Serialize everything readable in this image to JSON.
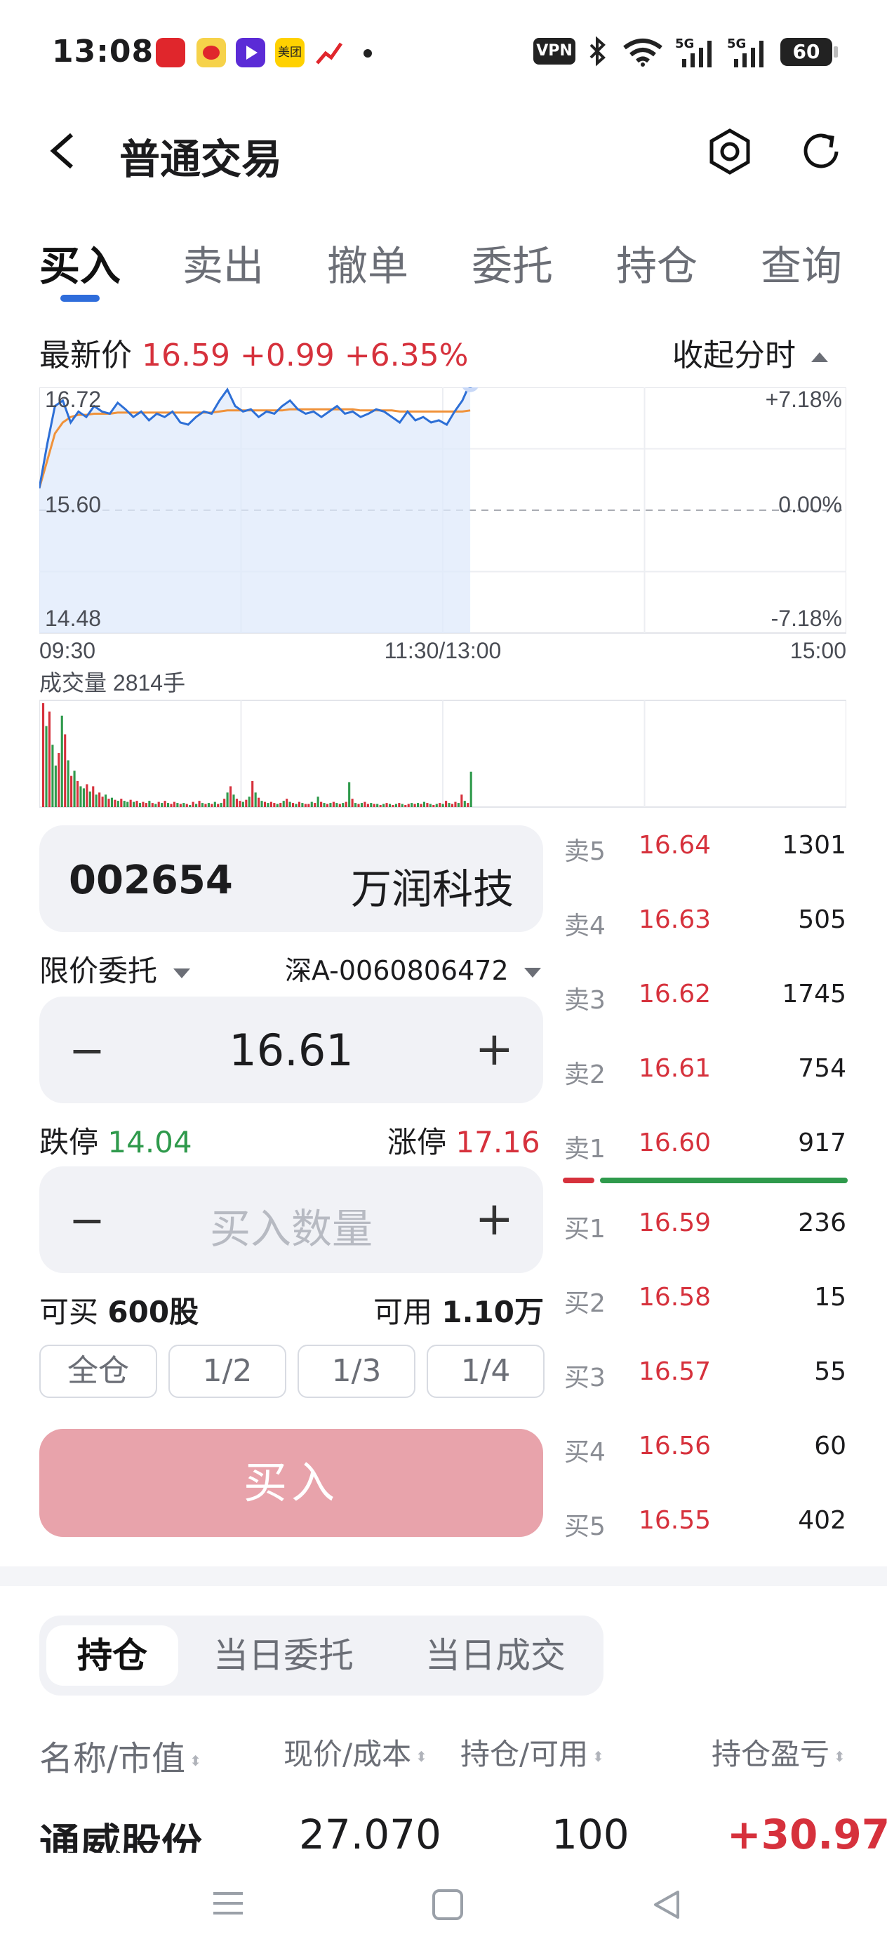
{
  "status_bar": {
    "time": "13:08",
    "vpn": "VPN",
    "battery": "60",
    "signal1": "5G",
    "signal2": "5G",
    "app_icons": [
      "app-icon-securities",
      "weibo-icon",
      "video-icon",
      "meituan-icon",
      "stock-icon"
    ],
    "meituan_label": "美团"
  },
  "header": {
    "title": "普通交易"
  },
  "tabs": [
    {
      "label": "买入",
      "active": true
    },
    {
      "label": "卖出"
    },
    {
      "label": "撤单"
    },
    {
      "label": "委托"
    },
    {
      "label": "持仓"
    },
    {
      "label": "查询"
    }
  ],
  "quote": {
    "label": "最新价",
    "price": "16.59",
    "change": "+0.99",
    "change_pct": "+6.35%",
    "collapse_label": "收起分时"
  },
  "chart_data": {
    "type": "line",
    "y_labels": [
      "16.72",
      "15.60",
      "14.48"
    ],
    "pct_labels": [
      "+7.18%",
      "0.00%",
      "-7.18%"
    ],
    "x_labels": [
      "09:30",
      "11:30/13:00",
      "15:00"
    ],
    "ylim": [
      14.48,
      16.72
    ],
    "prev_close": 15.6,
    "series": [
      {
        "values": [
          15.8,
          16.2,
          16.55,
          16.6,
          16.4,
          16.5,
          16.45,
          16.55,
          16.5,
          16.48,
          16.58,
          16.52,
          16.45,
          16.5,
          16.42,
          16.48,
          16.45,
          16.5,
          16.4,
          16.38,
          16.45,
          16.5,
          16.48,
          16.6,
          16.7,
          16.55,
          16.5,
          16.52,
          16.45,
          16.5,
          16.48,
          16.55,
          16.6,
          16.52,
          16.48,
          16.5,
          16.45,
          16.5,
          16.55,
          16.48,
          16.5,
          16.45,
          16.48,
          16.52,
          16.5,
          16.45,
          16.4,
          16.5,
          16.42,
          16.45,
          16.4,
          16.42,
          16.38,
          16.5,
          16.6,
          16.76
        ]
      },
      {
        "values": [
          15.8,
          16.05,
          16.3,
          16.4,
          16.45,
          16.47,
          16.47,
          16.48,
          16.48,
          16.48,
          16.49,
          16.49,
          16.49,
          16.49,
          16.49,
          16.49,
          16.49,
          16.49,
          16.49,
          16.49,
          16.49,
          16.49,
          16.49,
          16.5,
          16.51,
          16.51,
          16.51,
          16.51,
          16.51,
          16.51,
          16.51,
          16.51,
          16.52,
          16.52,
          16.52,
          16.52,
          16.52,
          16.52,
          16.52,
          16.52,
          16.52,
          16.51,
          16.51,
          16.51,
          16.51,
          16.51,
          16.5,
          16.5,
          16.5,
          16.5,
          16.5,
          16.5,
          16.5,
          16.5,
          16.5,
          16.51
        ]
      }
    ],
    "volume_label": "成交量 2814手",
    "volume": [
      100,
      78,
      92,
      60,
      40,
      52,
      88,
      70,
      45,
      30,
      35,
      25,
      20,
      18,
      22,
      15,
      20,
      12,
      14,
      10,
      12,
      8,
      9,
      7,
      6,
      8,
      6,
      5,
      7,
      5,
      6,
      4,
      5,
      4,
      6,
      4,
      3,
      5,
      4,
      6,
      4,
      3,
      5,
      4,
      3,
      4,
      3,
      2,
      5,
      3,
      6,
      4,
      3,
      4,
      3,
      5,
      3,
      4,
      8,
      14,
      20,
      12,
      8,
      6,
      5,
      7,
      10,
      25,
      14,
      9,
      6,
      5,
      4,
      5,
      4,
      3,
      4,
      6,
      8,
      5,
      4,
      3,
      5,
      4,
      3,
      3,
      5,
      4,
      10,
      5,
      4,
      3,
      4,
      5,
      4,
      3,
      4,
      5,
      24,
      8,
      4,
      3,
      4,
      5,
      3,
      4,
      3,
      3,
      2,
      3,
      4,
      3,
      2,
      3,
      4,
      3,
      2,
      3,
      4,
      3,
      4,
      3,
      5,
      4,
      3,
      2,
      3,
      4,
      3,
      6,
      4,
      3,
      5,
      4,
      12,
      6,
      4,
      34
    ],
    "volume_up": [
      true,
      false,
      true,
      false,
      false,
      true,
      false,
      true,
      false,
      true,
      false,
      true,
      false,
      false,
      true,
      false,
      true,
      false,
      true,
      true,
      false,
      true,
      false,
      true,
      false,
      true,
      false,
      false,
      true,
      false,
      true,
      false,
      true,
      true,
      false,
      true,
      false,
      true,
      false,
      true,
      false,
      true,
      true,
      false,
      true,
      false,
      true,
      false,
      true,
      false,
      true,
      false,
      true,
      false,
      true,
      false,
      true,
      false,
      true,
      false,
      true,
      false,
      true,
      true,
      false,
      true,
      false,
      true,
      false,
      true,
      false,
      true,
      false,
      true,
      true,
      false,
      true,
      false,
      true,
      false,
      true,
      false,
      true,
      false,
      true,
      true,
      false,
      true,
      false,
      true,
      false,
      true,
      false,
      true,
      false,
      true,
      false,
      true,
      false,
      true,
      false,
      true,
      false,
      true,
      true,
      false,
      true,
      false,
      true,
      false,
      true,
      false,
      true,
      false,
      true,
      false,
      true,
      true,
      false,
      true,
      false,
      true,
      false,
      true,
      false,
      true,
      false,
      true,
      false,
      true,
      false,
      true,
      true,
      false,
      true,
      false,
      true,
      false,
      true,
      true
    ]
  },
  "stock": {
    "code": "002654",
    "name": "万润科技"
  },
  "order_type": "限价委托",
  "account": "深A-0060806472",
  "price_input": {
    "value": "16.61",
    "minus": "−",
    "plus": "+"
  },
  "limits": {
    "down_label": "跌停",
    "down": "14.04",
    "up_label": "涨停",
    "up": "17.16"
  },
  "qty_input": {
    "placeholder": "买入数量",
    "minus": "−",
    "plus": "+"
  },
  "available": {
    "can_buy_label": "可买",
    "can_buy": "600股",
    "funds_label": "可用",
    "funds": "1.10万"
  },
  "fractions": [
    "全仓",
    "1/2",
    "1/3",
    "1/4"
  ],
  "buy_button": "买入",
  "order_book": {
    "asks": [
      {
        "label": "卖5",
        "price": "16.64",
        "vol": "1301"
      },
      {
        "label": "卖4",
        "price": "16.63",
        "vol": "505"
      },
      {
        "label": "卖3",
        "price": "16.62",
        "vol": "1745"
      },
      {
        "label": "卖2",
        "price": "16.61",
        "vol": "754"
      },
      {
        "label": "卖1",
        "price": "16.60",
        "vol": "917"
      }
    ],
    "bids": [
      {
        "label": "买1",
        "price": "16.59",
        "vol": "236"
      },
      {
        "label": "买2",
        "price": "16.58",
        "vol": "15"
      },
      {
        "label": "买3",
        "price": "16.57",
        "vol": "55"
      },
      {
        "label": "买4",
        "price": "16.56",
        "vol": "60"
      },
      {
        "label": "买5",
        "price": "16.55",
        "vol": "402"
      }
    ],
    "ratio_bar": {
      "ask_fraction": 0.12,
      "bid_fraction": 0.88
    }
  },
  "bottom_tabs": [
    {
      "label": "持仓",
      "active": true
    },
    {
      "label": "当日委托"
    },
    {
      "label": "当日成交"
    }
  ],
  "holdings_header": [
    "名称/市值",
    "现价/成本",
    "持仓/可用",
    "持仓盈亏"
  ],
  "holdings_rows": [
    {
      "name": "通威股份",
      "price": "27.070",
      "qty": "100",
      "pnl": "+30.97"
    }
  ],
  "colors": {
    "up": "#d6313c",
    "down": "#2f9a4c",
    "accent": "#2f6ddb",
    "line": "#2d6fd6",
    "avg": "#f0923a"
  }
}
